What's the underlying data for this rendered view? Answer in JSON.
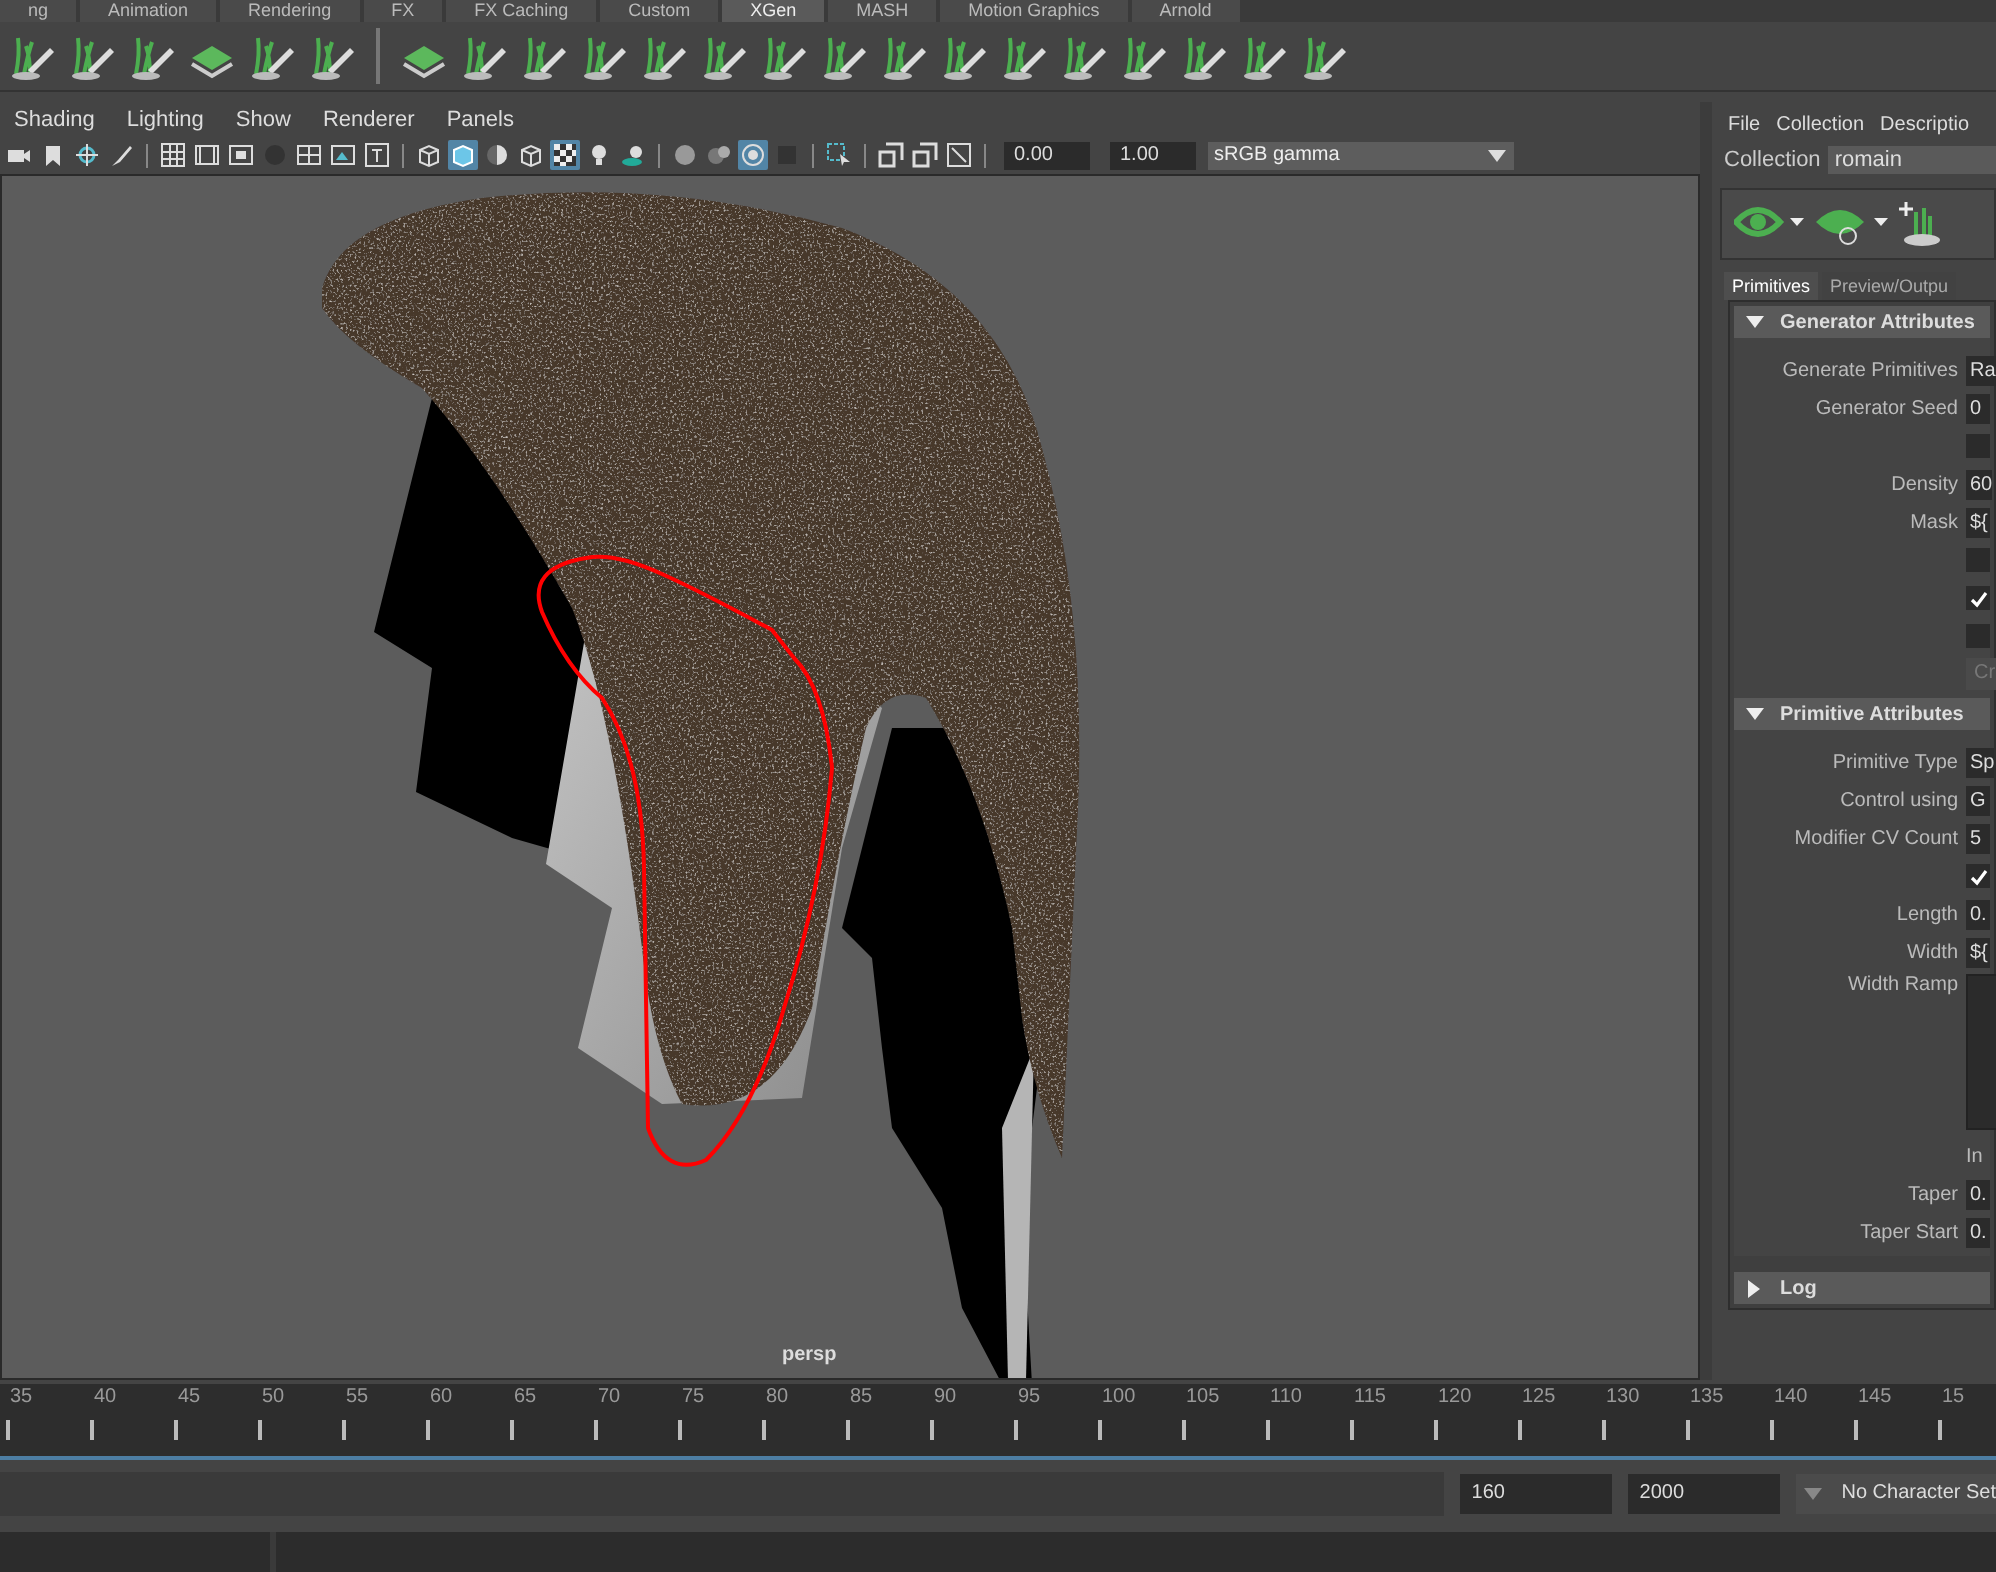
{
  "shelf_tabs": [
    {
      "label": "ng",
      "selected": false
    },
    {
      "label": "Animation",
      "selected": false
    },
    {
      "label": "Rendering",
      "selected": false
    },
    {
      "label": "FX",
      "selected": false
    },
    {
      "label": "FX Caching",
      "selected": false
    },
    {
      "label": "Custom",
      "selected": false
    },
    {
      "label": "XGen",
      "selected": true
    },
    {
      "label": "MASH",
      "selected": false
    },
    {
      "label": "Motion Graphics",
      "selected": false
    },
    {
      "label": "Arnold",
      "selected": false
    }
  ],
  "viewport": {
    "menus": [
      "Shading",
      "Lighting",
      "Show",
      "Renderer",
      "Panels"
    ],
    "toolbar": {
      "groups": [
        [
          {
            "kind": "camera",
            "selected": false
          },
          {
            "kind": "bookmark",
            "selected": false
          },
          {
            "kind": "pivot",
            "selected": false
          },
          {
            "kind": "brush",
            "selected": false
          }
        ],
        [
          {
            "kind": "grid",
            "selected": false
          },
          {
            "kind": "film",
            "selected": false
          },
          {
            "kind": "gate",
            "selected": false
          },
          {
            "kind": "dot",
            "selected": false
          },
          {
            "kind": "field",
            "selected": false
          },
          {
            "kind": "safe",
            "selected": false
          },
          {
            "kind": "title",
            "selected": false
          }
        ],
        [
          {
            "kind": "wire-cube",
            "selected": false
          },
          {
            "kind": "solid-cube",
            "selected": true
          },
          {
            "kind": "half-sphere",
            "selected": false
          },
          {
            "kind": "wire-cube",
            "selected": false
          },
          {
            "kind": "checker",
            "selected": true
          },
          {
            "kind": "bulb",
            "selected": false
          },
          {
            "kind": "shadow",
            "selected": false
          }
        ],
        [
          {
            "kind": "sphere",
            "selected": false
          },
          {
            "kind": "spheres",
            "selected": false
          },
          {
            "kind": "target",
            "selected": true
          },
          {
            "kind": "square",
            "selected": false
          }
        ],
        [
          {
            "kind": "select",
            "selected": false
          }
        ],
        [
          {
            "kind": "layers",
            "selected": false
          },
          {
            "kind": "layers",
            "selected": false
          },
          {
            "kind": "frame",
            "selected": false
          }
        ]
      ],
      "exposure": "0.00",
      "gamma": "1.00",
      "color_space": "sRGB gamma"
    },
    "camera_label": "persp"
  },
  "xgen_panel": {
    "menus": [
      "File",
      "Collection",
      "Descriptio"
    ],
    "collection_label": "Collection",
    "collection": "romain",
    "tabs": [
      {
        "label": "Primitives",
        "selected": true
      },
      {
        "label": "Preview/Outpu",
        "selected": false
      }
    ],
    "sections": [
      {
        "title": "Generator Attributes",
        "expanded": true,
        "rows": [
          {
            "kind": "field",
            "label": "Generate Primitives",
            "value": "Ra"
          },
          {
            "kind": "field",
            "label": "Generator Seed",
            "value": "0"
          },
          {
            "kind": "checkbox",
            "checked": false
          },
          {
            "kind": "field",
            "label": "Density",
            "value": "60"
          },
          {
            "kind": "field",
            "label": "Mask",
            "value": "${"
          },
          {
            "kind": "checkbox",
            "checked": false
          },
          {
            "kind": "checkbox",
            "checked": true
          },
          {
            "kind": "checkbox",
            "checked": false
          },
          {
            "kind": "button",
            "label": "Cr",
            "disabled": true
          }
        ]
      },
      {
        "title": "Primitive Attributes",
        "expanded": true,
        "rows": [
          {
            "kind": "field",
            "label": "Primitive Type",
            "value": "Sp"
          },
          {
            "kind": "field",
            "label": "Control using",
            "value": "G"
          },
          {
            "kind": "field",
            "label": "Modifier CV Count",
            "value": "5"
          },
          {
            "kind": "checkbox",
            "checked": true
          },
          {
            "kind": "field",
            "label": "Length",
            "value": "0."
          },
          {
            "kind": "field",
            "label": "Width",
            "value": "${"
          },
          {
            "kind": "ramp",
            "label": "Width Ramp"
          },
          {
            "kind": "note",
            "label": "In"
          },
          {
            "kind": "field",
            "label": "Taper",
            "value": "0."
          },
          {
            "kind": "field",
            "label": "Taper Start",
            "value": "0."
          }
        ]
      },
      {
        "title": "Log",
        "expanded": false
      }
    ]
  },
  "timeline": {
    "ticks": [
      "35",
      "40",
      "45",
      "50",
      "55",
      "60",
      "65",
      "70",
      "75",
      "80",
      "85",
      "90",
      "95",
      "100",
      "105",
      "110",
      "115",
      "120",
      "125",
      "130",
      "135",
      "140",
      "145",
      "15"
    ]
  },
  "range": {
    "start": "160",
    "end": "2000",
    "character_set": "No Character Set"
  }
}
